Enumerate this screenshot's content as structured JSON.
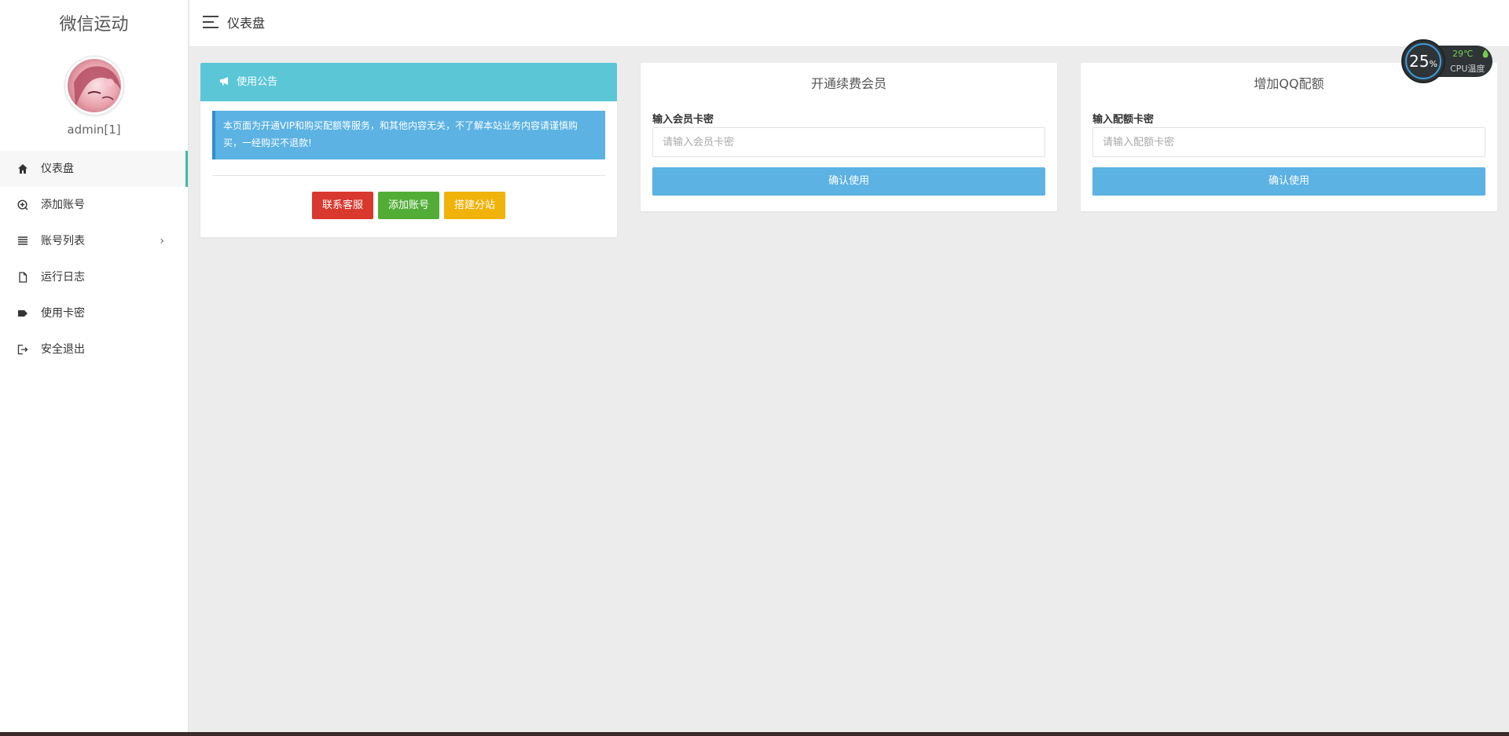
{
  "sidebar": {
    "brand": "微信运动",
    "username": "admin[1]",
    "items": [
      {
        "label": "仪表盘",
        "icon": "home-icon"
      },
      {
        "label": "添加账号",
        "icon": "plus-circle-icon"
      },
      {
        "label": "账号列表",
        "icon": "list-icon"
      },
      {
        "label": "运行日志",
        "icon": "file-icon"
      },
      {
        "label": "使用卡密",
        "icon": "tag-icon"
      },
      {
        "label": "安全退出",
        "icon": "logout-icon"
      }
    ],
    "list_arrow": "›"
  },
  "header": {
    "title": "仪表盘"
  },
  "notice": {
    "title": "使用公告",
    "text": "本页面为开通VIP和购买配额等服务，和其他内容无关，不了解本站业务内容请谨慎购买，一经购买不退款!",
    "buttons": {
      "contact": "联系客服",
      "add_account": "添加账号",
      "build_site": "搭建分站"
    }
  },
  "vip_form": {
    "title": "开通续费会员",
    "label": "输入会员卡密",
    "placeholder": "请输入会员卡密",
    "submit": "确认使用"
  },
  "qq_form": {
    "title": "增加QQ配额",
    "label": "输入配额卡密",
    "placeholder": "请输入配额卡密",
    "submit": "确认使用"
  },
  "cpu_widget": {
    "percent": "25",
    "percent_unit": "%",
    "temperature": "29℃",
    "label": "CPU温度"
  },
  "colors": {
    "accent": "#37bfa7",
    "notice_header": "#5bc7d6",
    "info": "#5bb2e3",
    "danger": "#d9382f",
    "success": "#52ad37",
    "warning": "#f1b30a"
  }
}
